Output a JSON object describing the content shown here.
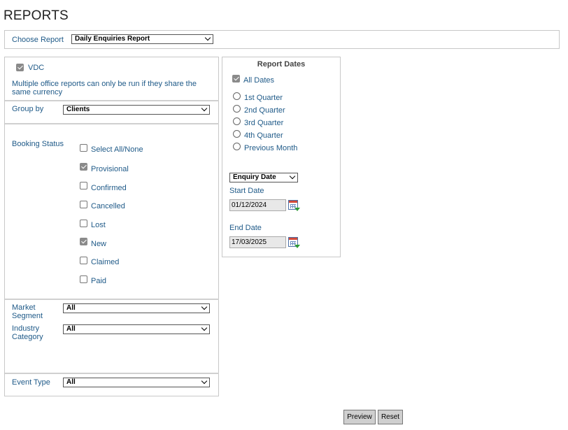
{
  "page": {
    "title": "REPORTS"
  },
  "choose_report": {
    "label": "Choose Report",
    "value": "Daily Enquiries Report"
  },
  "office": {
    "name": "VDC",
    "checked": true,
    "note": "Multiple office reports can only be run if they share the same currency"
  },
  "group_by": {
    "label": "Group by",
    "value": "Clients"
  },
  "booking_status": {
    "label": "Booking Status",
    "items": [
      {
        "label": "Select All/None",
        "checked": false
      },
      {
        "label": "Provisional",
        "checked": true
      },
      {
        "label": "Confirmed",
        "checked": false
      },
      {
        "label": "Cancelled",
        "checked": false
      },
      {
        "label": "Lost",
        "checked": false
      },
      {
        "label": "New",
        "checked": true
      },
      {
        "label": "Claimed",
        "checked": false
      },
      {
        "label": "Paid",
        "checked": false
      }
    ]
  },
  "market_segment": {
    "label_line1": "Market",
    "label_line2": "Segment",
    "value": "All"
  },
  "industry_category": {
    "label_line1": "Industry",
    "label_line2": "Category",
    "value": "All"
  },
  "event_type": {
    "label": "Event Type",
    "value": "All"
  },
  "report_dates": {
    "title": "Report Dates",
    "all_dates": {
      "label": "All Dates",
      "checked": true
    },
    "options": [
      "1st Quarter",
      "2nd Quarter",
      "3rd Quarter",
      "4th Quarter",
      "Previous Month"
    ],
    "date_type": "Enquiry Date",
    "start_label": "Start Date",
    "start_value": "01/12/2024",
    "end_label": "End Date",
    "end_value": "17/03/2025"
  },
  "actions": {
    "preview": "Preview",
    "reset": "Reset"
  }
}
